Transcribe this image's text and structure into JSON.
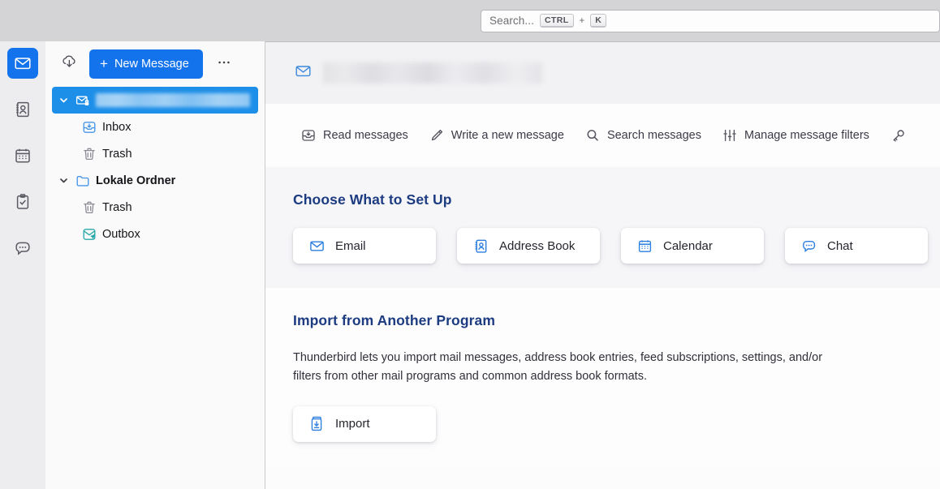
{
  "window": {
    "app": "Thunderbird",
    "titlebar_bg": "#d4d4d7"
  },
  "search": {
    "placeholder": "Search...",
    "shortcut_mod": "CTRL",
    "shortcut_plus": "+",
    "shortcut_key": "K"
  },
  "rail": {
    "items": [
      {
        "name": "mail",
        "label": "Mail",
        "icon": "envelope-icon",
        "active": true
      },
      {
        "name": "address-book",
        "label": "Address Book",
        "icon": "address-book-icon",
        "active": false
      },
      {
        "name": "calendar",
        "label": "Calendar",
        "icon": "calendar-icon",
        "active": false
      },
      {
        "name": "tasks",
        "label": "Tasks",
        "icon": "clipboard-check-icon",
        "active": false
      },
      {
        "name": "chat",
        "label": "Chat",
        "icon": "chat-bubble-icon",
        "active": false
      }
    ]
  },
  "folderpane": {
    "get_messages_icon": "cloud-download-icon",
    "new_message_label": "New Message",
    "new_message_plus": "+",
    "more_label": "…",
    "tree": [
      {
        "label": "",
        "redacted": true,
        "icon": "secure-mail-icon",
        "twisty": "chevron-down",
        "selected": true,
        "indent": 0,
        "bold": false
      },
      {
        "label": "Inbox",
        "redacted": false,
        "icon": "inbox-icon",
        "twisty": "",
        "selected": false,
        "indent": 1,
        "bold": false
      },
      {
        "label": "Trash",
        "redacted": false,
        "icon": "trash-icon",
        "twisty": "",
        "selected": false,
        "indent": 1,
        "bold": false
      },
      {
        "label": "Lokale Ordner",
        "redacted": false,
        "icon": "folder-icon",
        "twisty": "chevron-down",
        "selected": false,
        "indent": 0,
        "bold": true
      },
      {
        "label": "Trash",
        "redacted": false,
        "icon": "trash-icon",
        "twisty": "",
        "selected": false,
        "indent": 1,
        "bold": false
      },
      {
        "label": "Outbox",
        "redacted": false,
        "icon": "outbox-icon",
        "twisty": "",
        "selected": false,
        "indent": 1,
        "bold": false
      }
    ]
  },
  "account_header": {
    "icon": "envelope-icon",
    "name_redacted": true,
    "name": ""
  },
  "toolbar": {
    "links": [
      {
        "label": "Read messages",
        "icon": "inbox-icon"
      },
      {
        "label": "Write a new message",
        "icon": "pencil-icon"
      },
      {
        "label": "Search messages",
        "icon": "search-icon"
      },
      {
        "label": "Manage message filters",
        "icon": "filters-icon"
      },
      {
        "label": "",
        "icon": "key-icon"
      }
    ]
  },
  "setup_section": {
    "title": "Choose What to Set Up",
    "cards": [
      {
        "label": "Email",
        "icon": "envelope-icon"
      },
      {
        "label": "Address Book",
        "icon": "address-book-icon"
      },
      {
        "label": "Calendar",
        "icon": "calendar-icon"
      },
      {
        "label": "Chat",
        "icon": "chat-bubble-icon"
      }
    ]
  },
  "import_section": {
    "title": "Import from Another Program",
    "description": "Thunderbird lets you import mail messages, address book entries, feed subscriptions, settings, and/or filters from other mail programs and common address book formats.",
    "cards": [
      {
        "label": "Import",
        "icon": "import-icon"
      }
    ]
  },
  "colors": {
    "accent": "#1373ec",
    "selection": "#1e8fe8",
    "heading": "#1c3b80",
    "card_icon": "#2a7ee0"
  }
}
